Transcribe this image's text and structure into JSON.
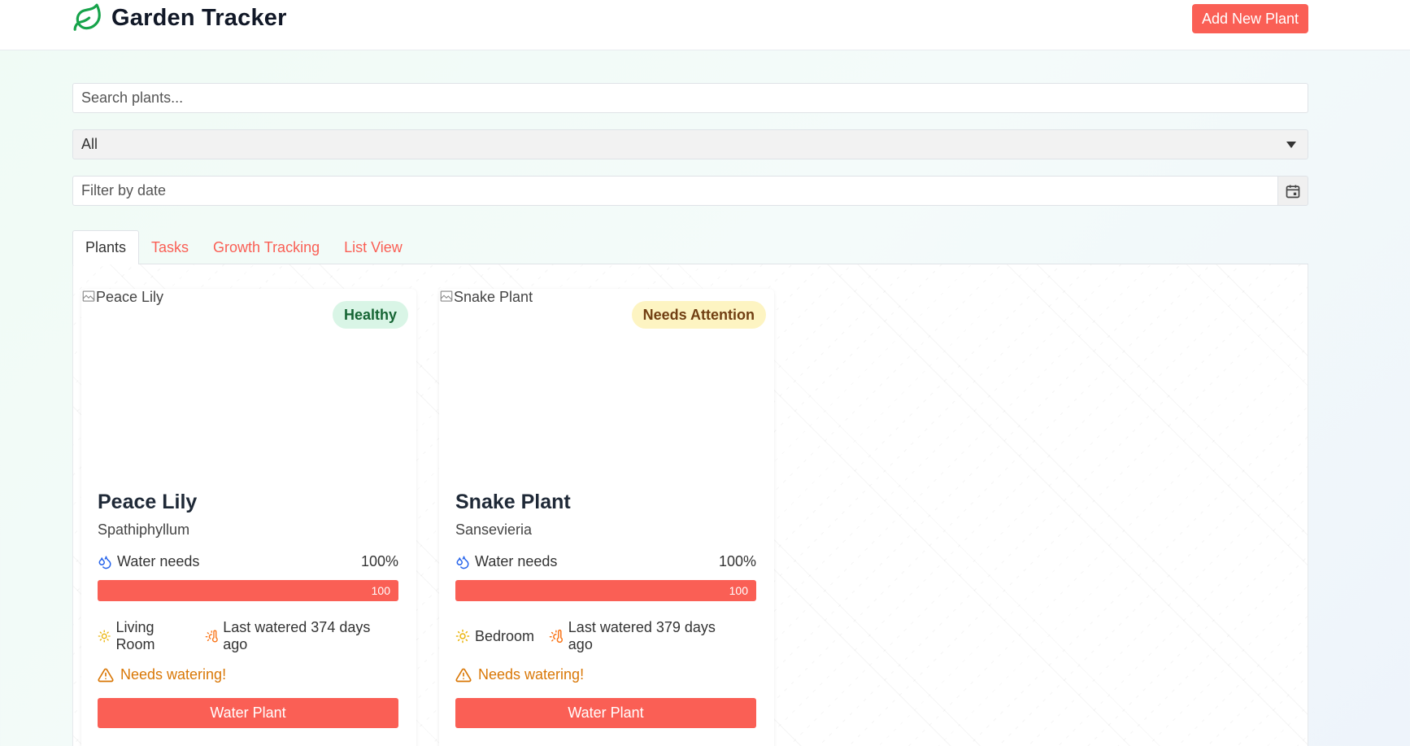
{
  "header": {
    "title": "Garden Tracker",
    "add_button": "Add New Plant"
  },
  "filters": {
    "search_placeholder": "Search plants...",
    "category_selected": "All",
    "date_placeholder": "Filter by date"
  },
  "tabs": [
    {
      "label": "Plants",
      "active": true
    },
    {
      "label": "Tasks",
      "active": false
    },
    {
      "label": "Growth Tracking",
      "active": false
    },
    {
      "label": "List View",
      "active": false
    }
  ],
  "plants": [
    {
      "image_alt": "Peace Lily",
      "status": "Healthy",
      "name": "Peace Lily",
      "scientific": "Spathiphyllum",
      "water_label": "Water needs",
      "water_percent": "100%",
      "water_value": "100",
      "location": "Living Room",
      "last_watered": "Last watered 374 days ago",
      "warning": "Needs watering!",
      "button": "Water Plant"
    },
    {
      "image_alt": "Snake Plant",
      "status": "Needs Attention",
      "name": "Snake Plant",
      "scientific": "Sansevieria",
      "water_label": "Water needs",
      "water_percent": "100%",
      "water_value": "100",
      "location": "Bedroom",
      "last_watered": "Last watered 379 days ago",
      "warning": "Needs watering!",
      "button": "Water Plant"
    }
  ],
  "colors": {
    "accent": "#fa5f55",
    "brand_leaf": "#16a34a",
    "healthy_bg": "#d9f5e6",
    "attention_bg": "#fdf4c2",
    "warning": "#d97706",
    "water_icon": "#2563eb",
    "sun_icon": "#eab308"
  }
}
